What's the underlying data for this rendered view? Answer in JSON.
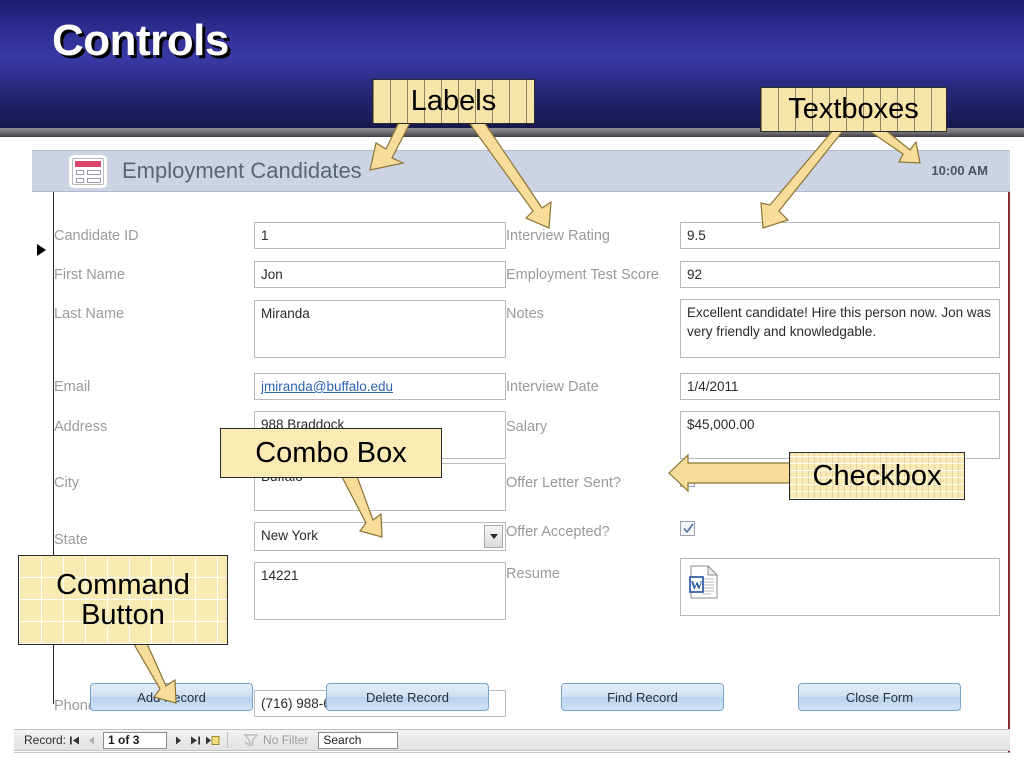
{
  "slide": {
    "title": "Controls"
  },
  "form": {
    "title": "Employment Candidates",
    "time": "10:00 AM",
    "icon": "form-icon",
    "left_fields": [
      {
        "label": "Candidate ID",
        "value": "1",
        "type": "textbox"
      },
      {
        "label": "First Name",
        "value": "Jon",
        "type": "textbox"
      },
      {
        "label": "Last Name",
        "value": "Miranda",
        "type": "textarea"
      },
      {
        "label": "Email",
        "value": "jmiranda@buffalo.edu",
        "type": "hyperlink"
      },
      {
        "label": "Address",
        "value": "988 Braddock",
        "type": "textarea"
      },
      {
        "label": "City",
        "value": "Buffalo",
        "type": "textarea"
      },
      {
        "label": "State",
        "value": "New York",
        "type": "combobox"
      },
      {
        "label": "",
        "value": "14221",
        "type": "textarea"
      },
      {
        "label": "Phone #",
        "value": "(716) 988-6572",
        "type": "textbox"
      }
    ],
    "right_fields": [
      {
        "label": "Interview Rating",
        "value": "9.5",
        "type": "textbox"
      },
      {
        "label": "Employment Test Score",
        "value": "92",
        "type": "textbox"
      },
      {
        "label": "Notes",
        "value": "Excellent candidate!  Hire this person now.   Jon was very friendly and knowledgable.",
        "type": "textarea"
      },
      {
        "label": "Interview Date",
        "value": "1/4/2011",
        "type": "textbox"
      },
      {
        "label": "Salary",
        "value": "$45,000.00",
        "type": "textarea"
      },
      {
        "label": "Offer Letter Sent?",
        "value": "checked",
        "type": "checkbox"
      },
      {
        "label": "Offer Accepted?",
        "value": "checked",
        "type": "checkbox"
      },
      {
        "label": "Resume",
        "value": "word-document-attachment",
        "type": "attachment"
      }
    ],
    "buttons": [
      {
        "label": "Add Record"
      },
      {
        "label": "Delete Record"
      },
      {
        "label": "Find Record"
      },
      {
        "label": "Close Form"
      }
    ]
  },
  "navbar": {
    "record_label": "Record:",
    "position": "1 of 3",
    "first_icon": "first-record-icon",
    "prev_icon": "previous-record-icon",
    "next_icon": "next-record-icon",
    "last_icon": "last-record-icon",
    "new_icon": "new-record-icon",
    "filter_icon": "filter-icon",
    "filter_label": "No Filter",
    "search_value": "Search"
  },
  "callouts": [
    {
      "id": "labels",
      "label": "Labels"
    },
    {
      "id": "textboxes",
      "label": "Textboxes"
    },
    {
      "id": "combo",
      "label": "Combo Box"
    },
    {
      "id": "checkbox",
      "label": "Checkbox"
    },
    {
      "id": "command",
      "label": "Command\nButton"
    },
    {
      "id": "command_line1",
      "label": "Command"
    },
    {
      "id": "command_line2",
      "label": "Button"
    }
  ],
  "colors": {
    "slide_bg": "#2b2b8c",
    "callout_fill": "#f8e5ab",
    "arrow_fill": "#f7dc9a",
    "arrow_stroke": "#8a7434",
    "form_bar": "#ccd3e3",
    "label_gray": "#9a9a9a",
    "link_blue": "#2d63b0",
    "button_blue": "#b8d3ef",
    "accent_red": "#8c2c2c"
  }
}
